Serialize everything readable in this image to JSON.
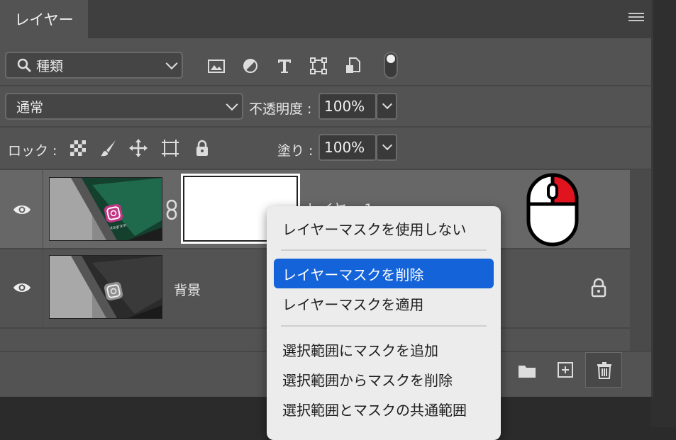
{
  "panel": {
    "tab_label": "レイヤー"
  },
  "filter": {
    "kind_label": "種類",
    "icons": [
      "image-filter-icon",
      "adjustment-filter-icon",
      "type-filter-icon",
      "shape-filter-icon",
      "smart-object-filter-icon"
    ]
  },
  "blend": {
    "mode": "通常",
    "opacity_label": "不透明度 :",
    "opacity_value": "100%"
  },
  "lock": {
    "label": "ロック :",
    "fill_label": "塗り :",
    "fill_value": "100%"
  },
  "layers": [
    {
      "name": "レイヤー 1",
      "visible": true,
      "has_mask": true,
      "selected": true
    },
    {
      "name": "背景",
      "visible": true,
      "locked": true,
      "selected": false
    }
  ],
  "context_menu": {
    "items": [
      {
        "label": "レイヤーマスクを使用しない"
      },
      {
        "label": "レイヤーマスクを削除"
      },
      {
        "label": "レイヤーマスクを適用"
      },
      {
        "label": "選択範囲にマスクを追加"
      },
      {
        "label": "選択範囲からマスクを削除"
      },
      {
        "label": "選択範囲とマスクの共通範囲"
      }
    ],
    "highlighted_index": 1
  },
  "colors": {
    "panel": "#535353",
    "menu_highlight": "#1463d8",
    "mouse_button": "#e0141e"
  },
  "annotation": {
    "icon": "right-click-mouse-icon"
  }
}
